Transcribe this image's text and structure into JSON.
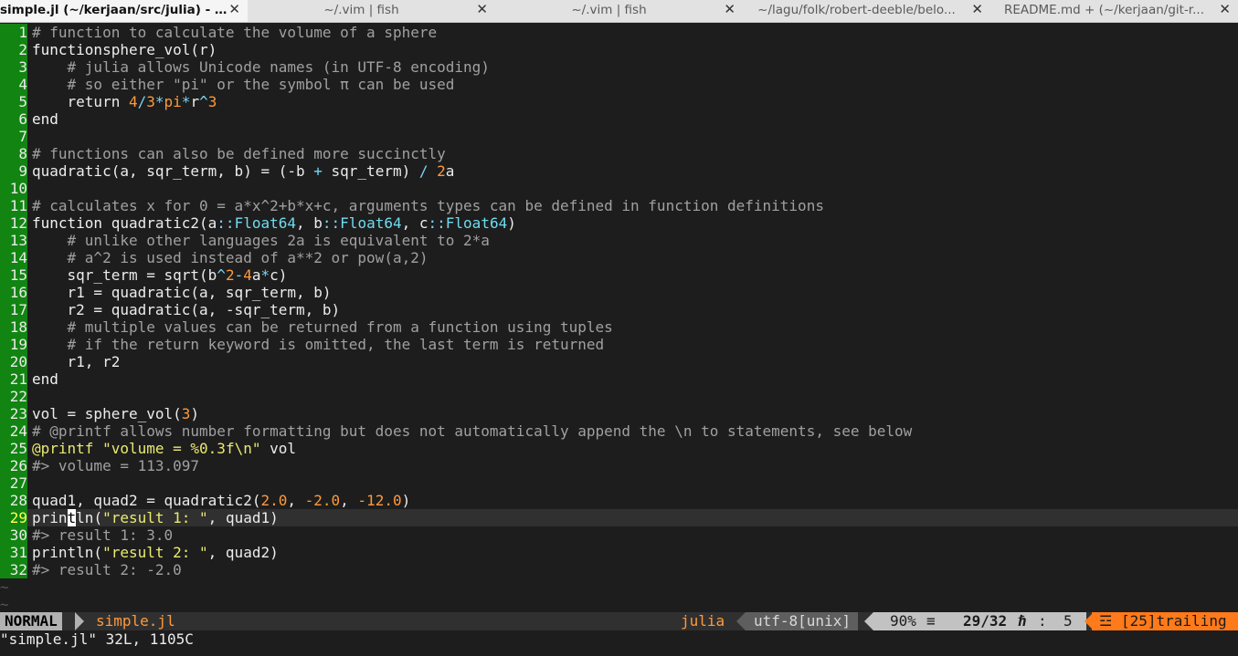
{
  "tabs": [
    {
      "title": "simple.jl (~/kerjaan/src/julia) - ...",
      "active": true
    },
    {
      "title": "~/.vim | fish",
      "active": false
    },
    {
      "title": "~/.vim | fish",
      "active": false
    },
    {
      "title": "~/lagu/folk/robert-deeble/belo...",
      "active": false
    },
    {
      "title": "README.md + (~/kerjaan/git-r...",
      "active": false
    }
  ],
  "tab_close_glyph": "✕",
  "lines": [
    [
      [
        "cm",
        "# function to calculate the volume of a sphere"
      ]
    ],
    [
      [
        "kw",
        "function"
      ],
      [
        "",
        "sphere_vol(r)"
      ]
    ],
    [
      [
        "",
        "    "
      ],
      [
        "cm",
        "# julia allows Unicode names (in UTF-8 encoding)"
      ]
    ],
    [
      [
        "",
        "    "
      ],
      [
        "cm",
        "# so either \"pi\" or the symbol π can be used"
      ]
    ],
    [
      [
        "",
        "    return "
      ],
      [
        "num",
        "4"
      ],
      [
        "op",
        "/"
      ],
      [
        "num",
        "3"
      ],
      [
        "op",
        "*"
      ],
      [
        "num",
        "pi"
      ],
      [
        "op",
        "*"
      ],
      [
        "",
        "r"
      ],
      [
        "op",
        "^"
      ],
      [
        "num",
        "3"
      ]
    ],
    [
      [
        "kw",
        "end"
      ]
    ],
    [
      [
        "",
        ""
      ]
    ],
    [
      [
        "cm",
        "# functions can also be defined more succinctly"
      ]
    ],
    [
      [
        "",
        "quadratic(a, sqr_term, b) = (-b "
      ],
      [
        "op",
        "+"
      ],
      [
        "",
        ""
      ],
      [
        "",
        ""
      ],
      [
        "",
        ""
      ],
      [
        "",
        ""
      ],
      [
        "",
        ""
      ],
      [
        "",
        ""
      ],
      [
        "",
        ""
      ],
      [
        "",
        ""
      ],
      [
        "",
        ""
      ],
      [
        "",
        ""
      ],
      [
        "",
        ""
      ],
      [
        "",
        ""
      ],
      [
        "",
        ""
      ],
      [
        "",
        ""
      ],
      [
        "",
        ""
      ],
      [
        "",
        ""
      ],
      [
        "",
        ""
      ],
      [
        "",
        ""
      ],
      [
        "",
        ""
      ],
      [
        "",
        ""
      ],
      [
        "",
        ""
      ],
      [
        "",
        ""
      ],
      [
        "",
        ""
      ],
      [
        "",
        ""
      ],
      [
        "",
        ""
      ],
      [
        "",
        ""
      ],
      [
        "",
        ""
      ],
      [
        "",
        ""
      ],
      [
        "",
        ""
      ],
      [
        "",
        ""
      ],
      [
        "",
        ""
      ],
      [
        "",
        ""
      ],
      [
        "",
        ""
      ],
      [
        "",
        ""
      ],
      [
        "",
        ""
      ],
      [
        "",
        ""
      ],
      [
        "",
        ""
      ],
      [
        "",
        ""
      ],
      [
        "",
        ""
      ],
      [
        "",
        ""
      ],
      [
        "",
        ""
      ],
      [
        "",
        ""
      ],
      [
        "",
        ""
      ],
      [
        "",
        ""
      ],
      [
        "",
        ""
      ],
      [
        "",
        ""
      ],
      [
        "",
        ""
      ],
      [
        "",
        ""
      ],
      [
        "",
        ""
      ],
      [
        "",
        ""
      ],
      [
        "",
        ""
      ],
      [
        "",
        ""
      ],
      [
        "",
        ""
      ],
      [
        "",
        ""
      ],
      [
        "",
        ""
      ],
      [
        "",
        ""
      ],
      [
        "",
        ""
      ],
      [
        "",
        ""
      ],
      [
        "",
        ""
      ],
      [
        "",
        ""
      ],
      [
        "",
        ""
      ],
      [
        "",
        ""
      ],
      [
        "",
        ""
      ],
      [
        "",
        ""
      ],
      [
        "",
        ""
      ],
      [
        "",
        ""
      ],
      [
        "",
        ""
      ],
      [
        "",
        ""
      ],
      [
        "",
        ""
      ],
      [
        "",
        ""
      ],
      [
        "",
        ""
      ],
      [
        "",
        ""
      ],
      [
        "",
        ""
      ],
      [
        "",
        ""
      ],
      [
        "",
        ""
      ],
      [
        "",
        ""
      ],
      [
        "",
        ""
      ],
      [
        "",
        ""
      ],
      [
        "",
        ""
      ],
      [
        "",
        ""
      ],
      [
        "",
        ""
      ],
      [
        "",
        ""
      ],
      [
        "",
        ""
      ],
      [
        "",
        ""
      ],
      [
        "",
        ""
      ],
      [
        "",
        ""
      ],
      [
        "",
        ""
      ],
      [
        "",
        ""
      ],
      [
        "",
        " sqr_term) "
      ],
      [
        "op",
        "/"
      ],
      [
        "",
        " "
      ],
      [
        "num",
        "2"
      ],
      [
        "",
        "a"
      ]
    ],
    [
      [
        "",
        ""
      ]
    ],
    [
      [
        "cm",
        "# calculates x for 0 = a*x^2+b*x+c, arguments types can be defined in function definitions"
      ]
    ],
    [
      [
        "kw",
        "function"
      ],
      [
        "",
        " quadratic2(a"
      ],
      [
        "op",
        "::"
      ],
      [
        "ty",
        "Float64"
      ],
      [
        "",
        ", b"
      ],
      [
        "op",
        "::"
      ],
      [
        "ty",
        "Float64"
      ],
      [
        "",
        ", c"
      ],
      [
        "op",
        "::"
      ],
      [
        "ty",
        "Float64"
      ],
      [
        "",
        ")"
      ]
    ],
    [
      [
        "",
        "    "
      ],
      [
        "cm",
        "# unlike other languages 2a is equivalent to 2*a"
      ]
    ],
    [
      [
        "",
        "    "
      ],
      [
        "cm",
        "# a^2 is used instead of a**2 or pow(a,2)"
      ]
    ],
    [
      [
        "",
        "    sqr_term = sqrt(b"
      ],
      [
        "op",
        "^"
      ],
      [
        "num",
        "2"
      ],
      [
        "op",
        "-"
      ],
      [
        "num",
        "4"
      ],
      [
        "",
        "a"
      ],
      [
        "op",
        "*"
      ],
      [
        "",
        "c)"
      ]
    ],
    [
      [
        "",
        "    r1 = quadratic(a, sqr_term, b)"
      ]
    ],
    [
      [
        "",
        "    r2 = quadratic(a, -sqr_term, b)"
      ]
    ],
    [
      [
        "",
        "    "
      ],
      [
        "cm",
        "# multiple values can be returned from a function using tuples"
      ]
    ],
    [
      [
        "",
        "    "
      ],
      [
        "cm",
        "# if the return keyword is omitted, the last term is returned"
      ]
    ],
    [
      [
        "",
        "    r1, r2"
      ]
    ],
    [
      [
        "kw",
        "end"
      ]
    ],
    [
      [
        "",
        ""
      ]
    ],
    [
      [
        "",
        "vol = sphere_vol("
      ],
      [
        "num",
        "3"
      ],
      [
        "",
        ")"
      ]
    ],
    [
      [
        "cm",
        "# @printf allows number formatting but does not automatically append the \\n to statements, see below"
      ]
    ],
    [
      [
        "mac",
        "@printf"
      ],
      [
        "",
        " "
      ],
      [
        "str",
        "\"volume = %0.3f\\n\""
      ],
      [
        "",
        " vol"
      ]
    ],
    [
      [
        "cm",
        "#> volume = 113.097"
      ]
    ],
    [
      [
        "",
        ""
      ]
    ],
    [
      [
        "",
        "quad1, quad2 = quadratic2("
      ],
      [
        "num",
        "2.0"
      ],
      [
        "",
        ", "
      ],
      [
        "num",
        "-2.0"
      ],
      [
        "",
        ", "
      ],
      [
        "num",
        "-12.0"
      ],
      [
        "",
        ")"
      ]
    ],
    [
      [
        "",
        "prin"
      ],
      [
        "cursor",
        "t"
      ],
      [
        "",
        "ln("
      ],
      [
        "str",
        "\"result 1: \""
      ],
      [
        "",
        ", quad1)"
      ]
    ],
    [
      [
        "cm",
        "#> result 1: 3.0"
      ]
    ],
    [
      [
        "",
        "println("
      ],
      [
        "str",
        "\"result 2: \""
      ],
      [
        "",
        ", quad2)"
      ]
    ],
    [
      [
        "cm",
        "#> result 2: -2.0"
      ]
    ]
  ],
  "cursor_line": 29,
  "tilde": "~",
  "statusline": {
    "mode": "NORMAL",
    "file": "simple.jl",
    "filetype": "julia",
    "encoding": "utf-8[unix]",
    "percent": "90%",
    "percent_icon": "≡",
    "position": "29/32",
    "line_icon": "ℏ",
    "colon": ":",
    "column": "5",
    "warn_icon": "☲",
    "warning": "[25]trailing"
  },
  "cmdline": "\"simple.jl\" 32L, 1105C",
  "colors": {
    "linenr_bg": "#128412",
    "string": "#eaea70",
    "number": "#ff9a3c",
    "operator": "#7ad4f7",
    "comment": "#a0a0a0",
    "warning_bg": "#ff7a1a"
  }
}
